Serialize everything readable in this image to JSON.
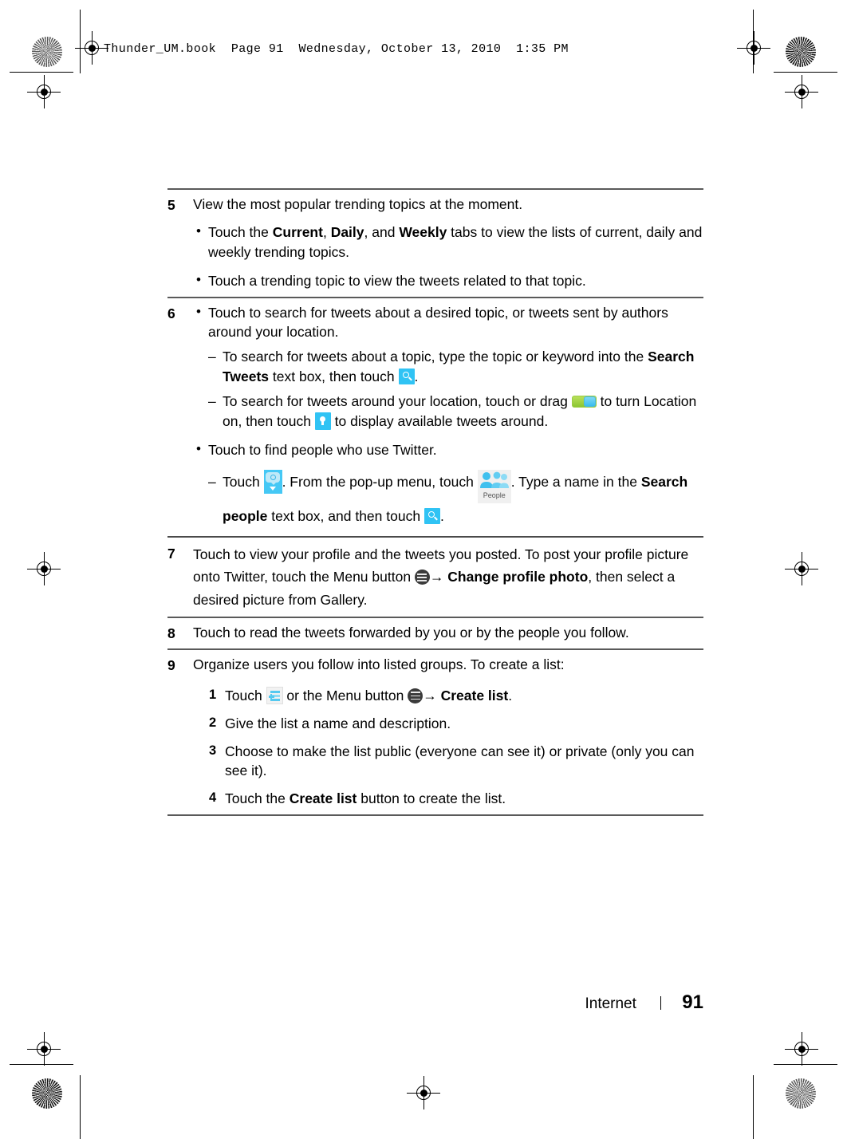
{
  "slug": "Thunder_UM.book  Page 91  Wednesday, October 13, 2010  1:35 PM",
  "colors": {
    "icon_blue": "#30c3f4",
    "toggle_green": "#8cc631",
    "toggle_knob_blue": "#39bdee",
    "rule_gray": "#5a5a5a",
    "text_black": "#000000"
  },
  "steps": [
    {
      "number": "5",
      "intro": "View the most popular trending topics at the moment.",
      "bullets": [
        {
          "parts": [
            {
              "t": "Touch the ",
              "b": false
            },
            {
              "t": "Current",
              "b": true
            },
            {
              "t": ", ",
              "b": false
            },
            {
              "t": "Daily",
              "b": true
            },
            {
              "t": ", and ",
              "b": false
            },
            {
              "t": "Weekly",
              "b": true
            },
            {
              "t": " tabs to view the lists of current, daily and weekly trending topics.",
              "b": false
            }
          ]
        },
        {
          "parts": [
            {
              "t": "Touch a trending topic to view the tweets related to that topic.",
              "b": false
            }
          ]
        }
      ]
    },
    {
      "number": "6",
      "bullet1": "Touch to search for tweets about a desired topic, or tweets sent by authors around your location.",
      "dash1_a": "To search for tweets about a topic, type the topic or keyword into the ",
      "dash1_bold": "Search Tweets",
      "dash1_b": " text box, then touch ",
      "dash1_end": ".",
      "dash2_a": "To search for tweets around your location, touch or drag ",
      "dash2_b": " to turn Location on, then touch ",
      "dash2_c": " to display available tweets around.",
      "bullet2": "Touch to find people who use Twitter.",
      "dash3_a": "Touch ",
      "dash3_b": ". From the pop-up menu, touch ",
      "dash3_c": ". Type a name in the ",
      "dash3_bold": "Search people",
      "dash3_d": " text box, and then touch ",
      "dash3_end": "."
    },
    {
      "number": "7",
      "a": "Touch to view your profile and the tweets you posted. To post your profile picture onto Twitter, touch the Menu button ",
      "arrow": "→ ",
      "bold1": "Change profile photo",
      "b": ", then select a desired picture from Gallery."
    },
    {
      "number": "8",
      "text": "Touch to read the tweets forwarded by you or by the people you follow."
    },
    {
      "number": "9",
      "intro": "Organize users you follow into listed groups. To create a list:",
      "sub": [
        {
          "n": "1",
          "a": "Touch ",
          "b": " or the Menu button ",
          "arrow": "→ ",
          "bold": "Create list",
          "c": "."
        },
        {
          "n": "2",
          "text": "Give the list a name and description."
        },
        {
          "n": "3",
          "text": "Choose to make the list public (everyone can see it) or private (only you can see it)."
        },
        {
          "n": "4",
          "a": "Touch the ",
          "bold": "Create list",
          "c": " button to create the list."
        }
      ]
    }
  ],
  "icons": {
    "search": "search-icon",
    "toggle": "location-toggle-switch",
    "pin": "location-pin-icon",
    "bubble": "search-bubble-icon",
    "people": "people-icon",
    "people_label": "People",
    "menu": "menu-button-icon",
    "create_list": "create-list-icon"
  },
  "footer": {
    "chapter": "Internet",
    "page": "91"
  }
}
